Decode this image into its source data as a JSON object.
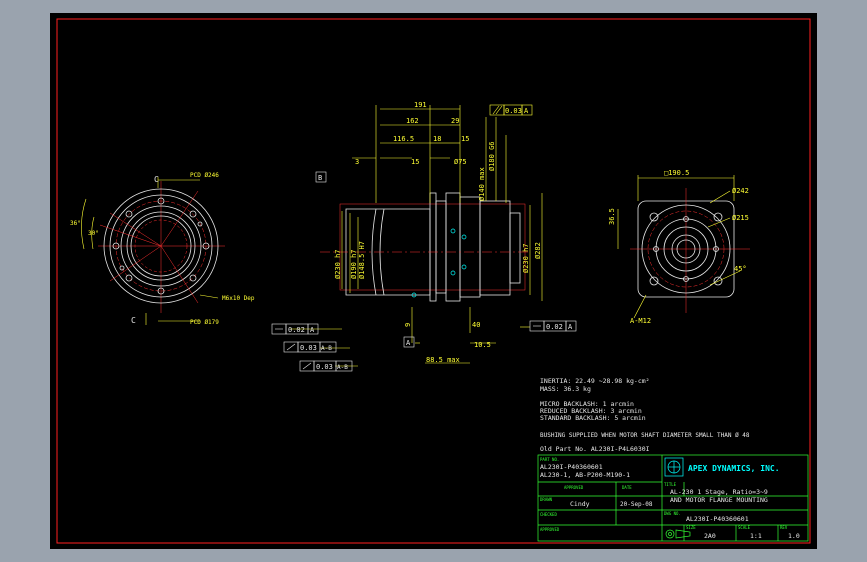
{
  "dims": {
    "top_191": "191",
    "top_162": "162",
    "top_29": "29",
    "top_116_5": "116.5",
    "top_18": "18",
    "top_15a": "15",
    "top_15b": "15",
    "top_3": "3",
    "top_75": "Ø75",
    "top_flat": "0.03",
    "top_flat_ref": "A",
    "v_140": "Ø140 max",
    "v_180": "Ø180 G6",
    "v_230h7": "Ø230 h7",
    "v_282": "Ø282",
    "v_190h7": "Ø190 h7",
    "v_148_5": "Ø148.5 H7",
    "v_230h7b": "Ø230 h7",
    "v_9": "9",
    "v_40": "40",
    "h_10_5": "10.5",
    "h_88_5": "88.5 max",
    "ref_b": "B",
    "ref_a": "A",
    "tol_left_1": "0.02",
    "tol_left_1_ref": "A",
    "tol_left_2": "0.03",
    "tol_left_2_ref": "A-B",
    "tol_left_3": "0.03",
    "tol_left_3_ref": "A-B",
    "tol_right": "0.02",
    "tol_right_ref": "A",
    "left_pcd246": "PCD Ø246",
    "left_pcd179": "PCD Ø179",
    "left_m6": "M6x10 Dep",
    "left_36": "36°",
    "left_30": "30°",
    "left_c1": "C",
    "left_c2": "C",
    "right_sq": "□190.5",
    "right_d242": "Ø242",
    "right_d215": "Ø215",
    "right_36_5": "36.5",
    "right_45": "45°",
    "right_a_m12": "A-M12"
  },
  "notes": {
    "inertia": "INERTIA: 22.49 ~28.98 kg-cm²",
    "mass": "MASS: 36.3 kg",
    "micro": "MICRO BACKLASH: 1 arcmin",
    "reduced": "REDUCED BACKLASH: 3 arcmin",
    "standard": "STANDARD BACKLASH: 5 arcmin",
    "bushing": "BUSHING SUPPLIED WHEN MOTOR SHAFT DIAMETER SMALL THAN Ø 48",
    "old_part": "Old Part No. AL230I-P4L6030I"
  },
  "title_block": {
    "part_no_label": "PART NO.",
    "part_no_1": "AL230I-P40360601",
    "part_no_2": "AL230-1, AB-P200-M190-1",
    "company": "APEX DYNAMICS, INC.",
    "approved_label": "APPROVED",
    "date_label": "DATE",
    "title_label": "TITLE",
    "title_1": "AL-230 1 Stage, Ratio=3~9",
    "title_2": "AND MOTOR FLANGE MOUNTING",
    "drawn_label": "DRAWN",
    "drawn_by": "Cindy",
    "drawn_date": "20-Sep-08",
    "checked_label": "CHECKED",
    "dwg_label": "DWG NO.",
    "dwg_no": "AL230I-P40360601",
    "approved2_label": "APPROVED",
    "size_label": "SIZE",
    "size": "2A0",
    "scale_label": "SCALE",
    "scale": "1:1",
    "rev_label": "REV",
    "rev": "1.0"
  },
  "colors": {
    "frame_red": "#ff2020",
    "dim_yellow": "#ffff33",
    "part_white": "#e8e8e8",
    "center_red": "#ff3030",
    "table_green": "#33ff33",
    "hole_cyan": "#00ffff"
  }
}
